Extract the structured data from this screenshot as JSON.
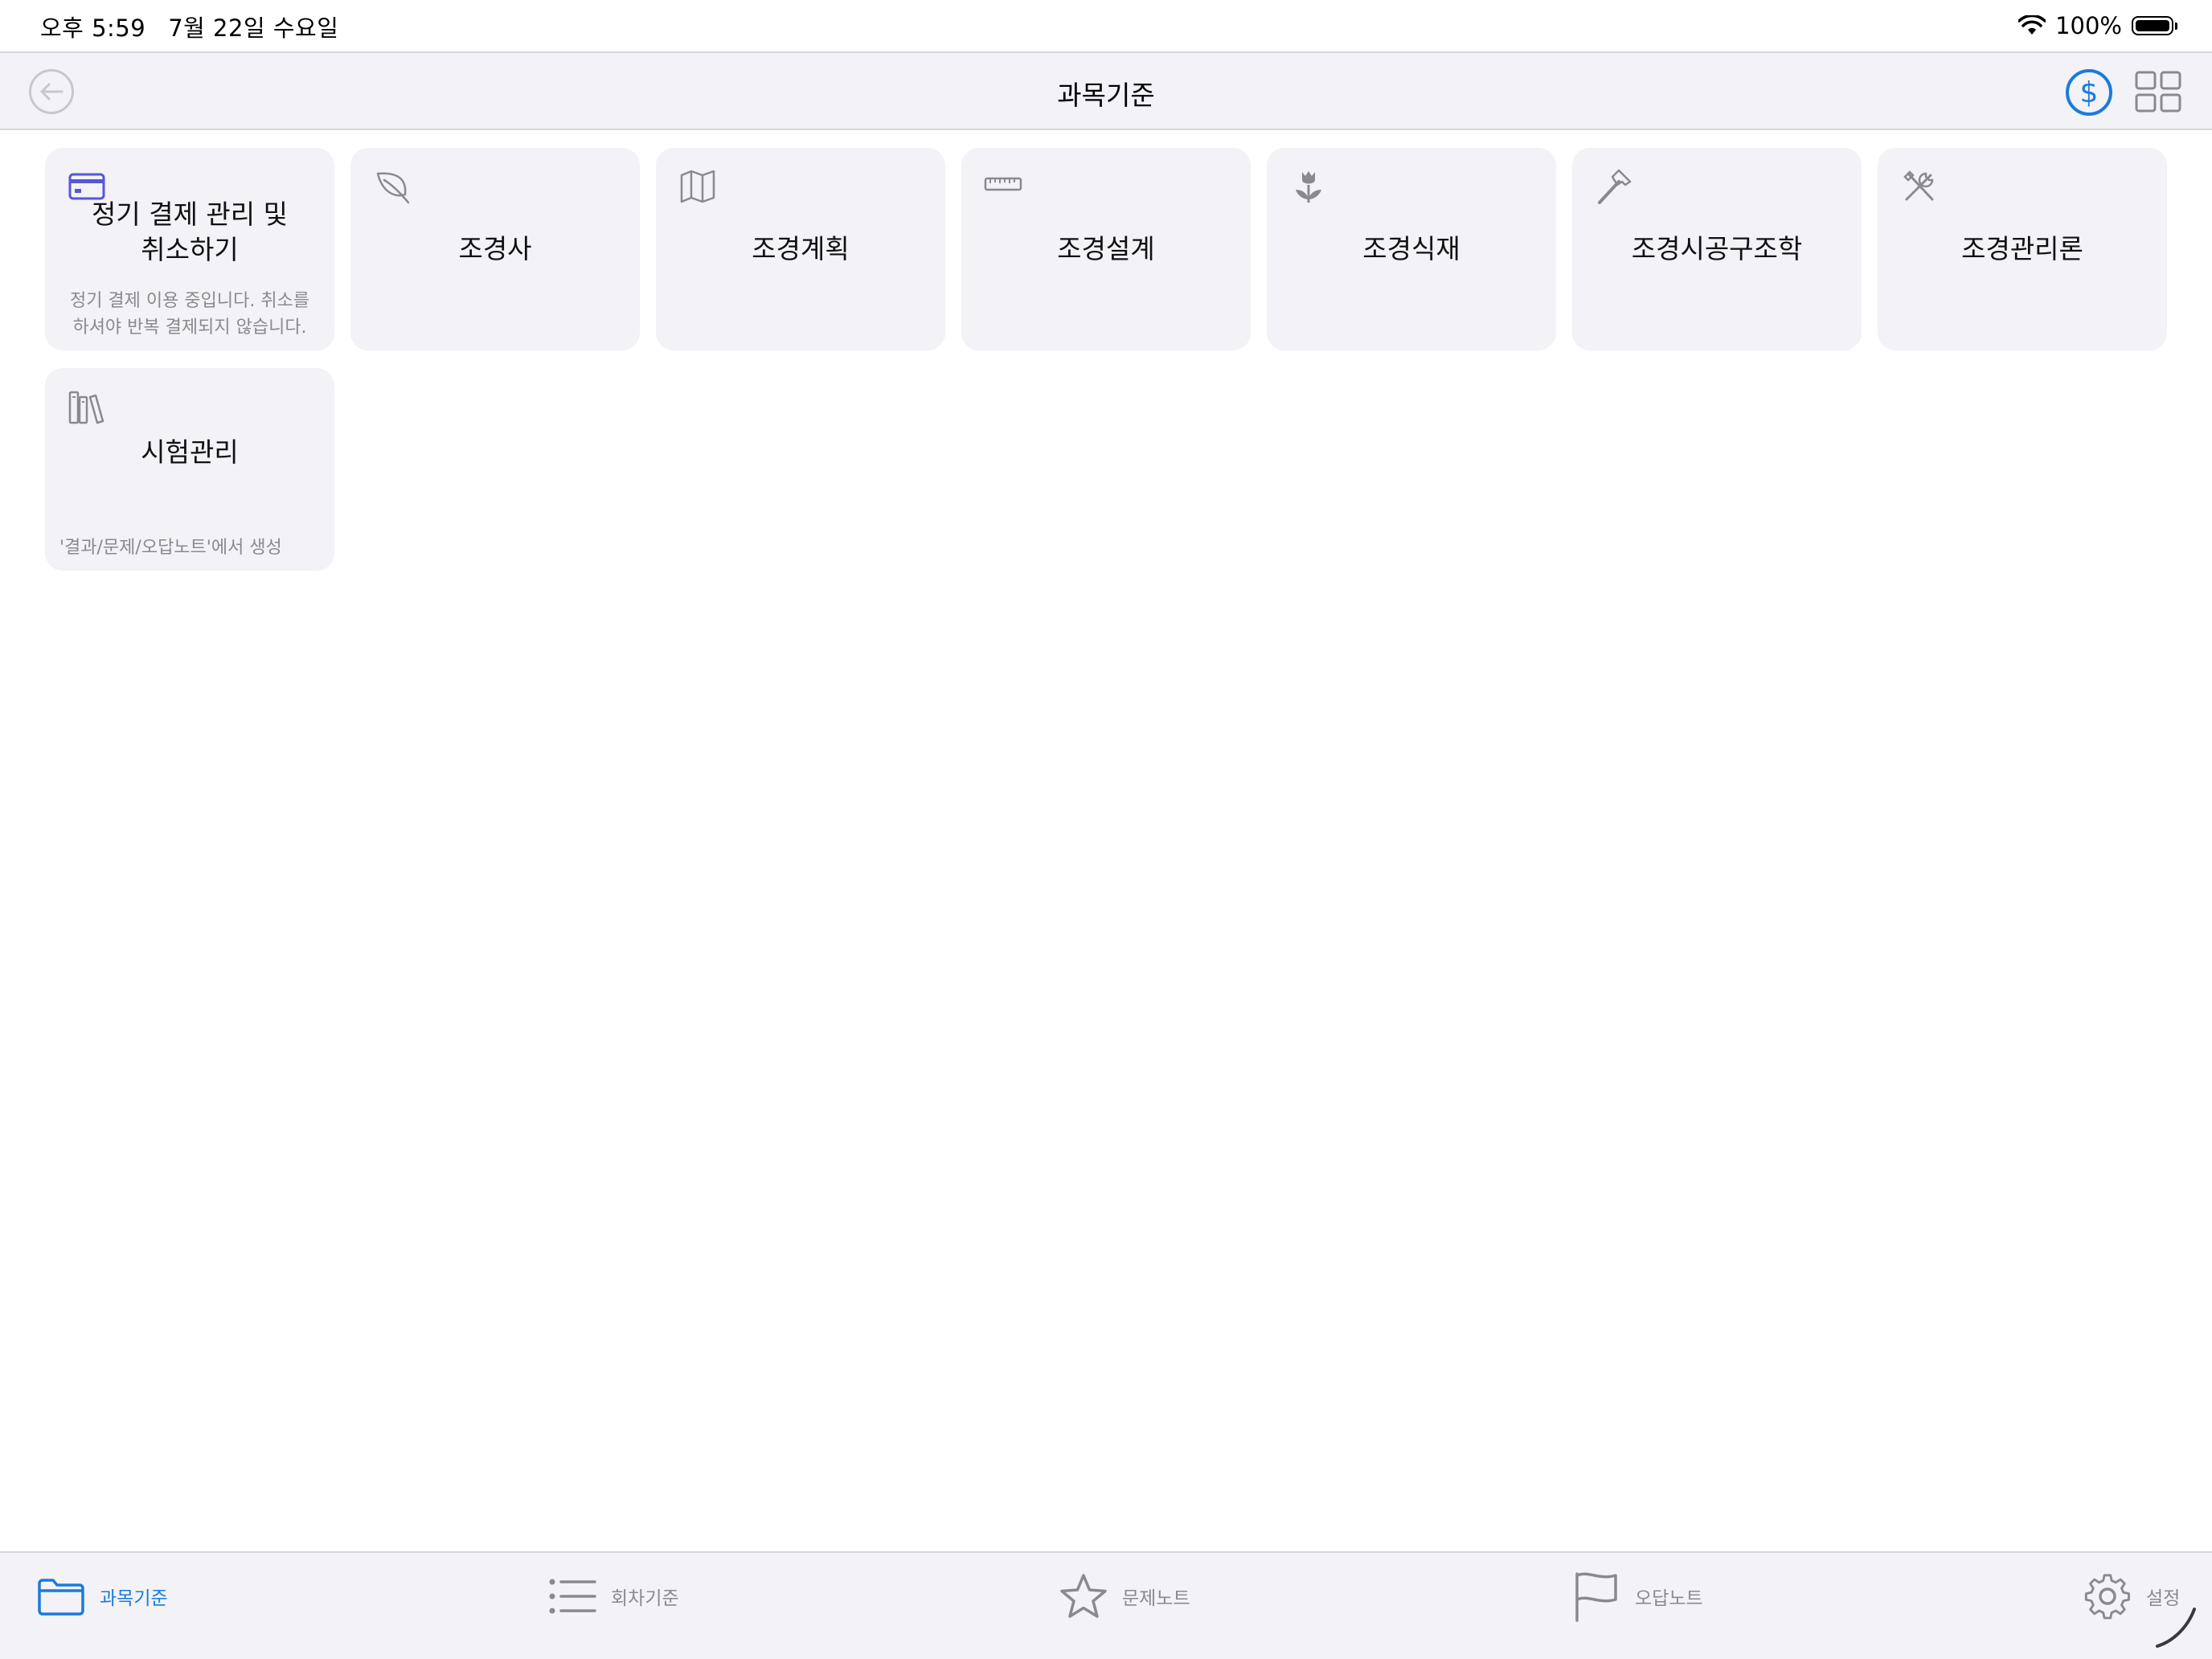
{
  "status": {
    "time": "오후 5:59",
    "date": "7월 22일 수요일",
    "battery": "100%"
  },
  "nav": {
    "title": "과목기준",
    "back_icon": "arrow-left-circle-icon",
    "dollar_symbol": "$",
    "grid_icon": "grid-icon"
  },
  "cards": [
    {
      "title": "정기 결제 관리 및\n취소하기",
      "subtitle": "정기 결제 이용 중입니다. 취소를 하셔야 반복 결제되지 않습니다.",
      "icon": "credit-card-icon"
    },
    {
      "title": "조경사",
      "icon": "leaf-icon"
    },
    {
      "title": "조경계획",
      "icon": "map-icon"
    },
    {
      "title": "조경설계",
      "icon": "ruler-icon"
    },
    {
      "title": "조경식재",
      "icon": "tulip-icon"
    },
    {
      "title": "조경시공구조학",
      "icon": "hammer-icon"
    },
    {
      "title": "조경관리론",
      "icon": "tools-icon"
    },
    {
      "title": "시험관리",
      "subtitle": "'결과/문제/오답노트'에서 생성",
      "icon": "books-icon"
    }
  ],
  "tabs": [
    {
      "label": "과목기준",
      "icon": "folder-icon",
      "active": true
    },
    {
      "label": "회차기준",
      "icon": "list-icon",
      "active": false
    },
    {
      "label": "문제노트",
      "icon": "star-icon",
      "active": false
    },
    {
      "label": "오답노트",
      "icon": "flag-icon",
      "active": false
    },
    {
      "label": "설정",
      "icon": "gear-icon",
      "active": false
    }
  ],
  "colors": {
    "accent": "#1a7bdc",
    "card_icon_purple": "#5856d6",
    "card_bg": "#f2f2f7"
  }
}
